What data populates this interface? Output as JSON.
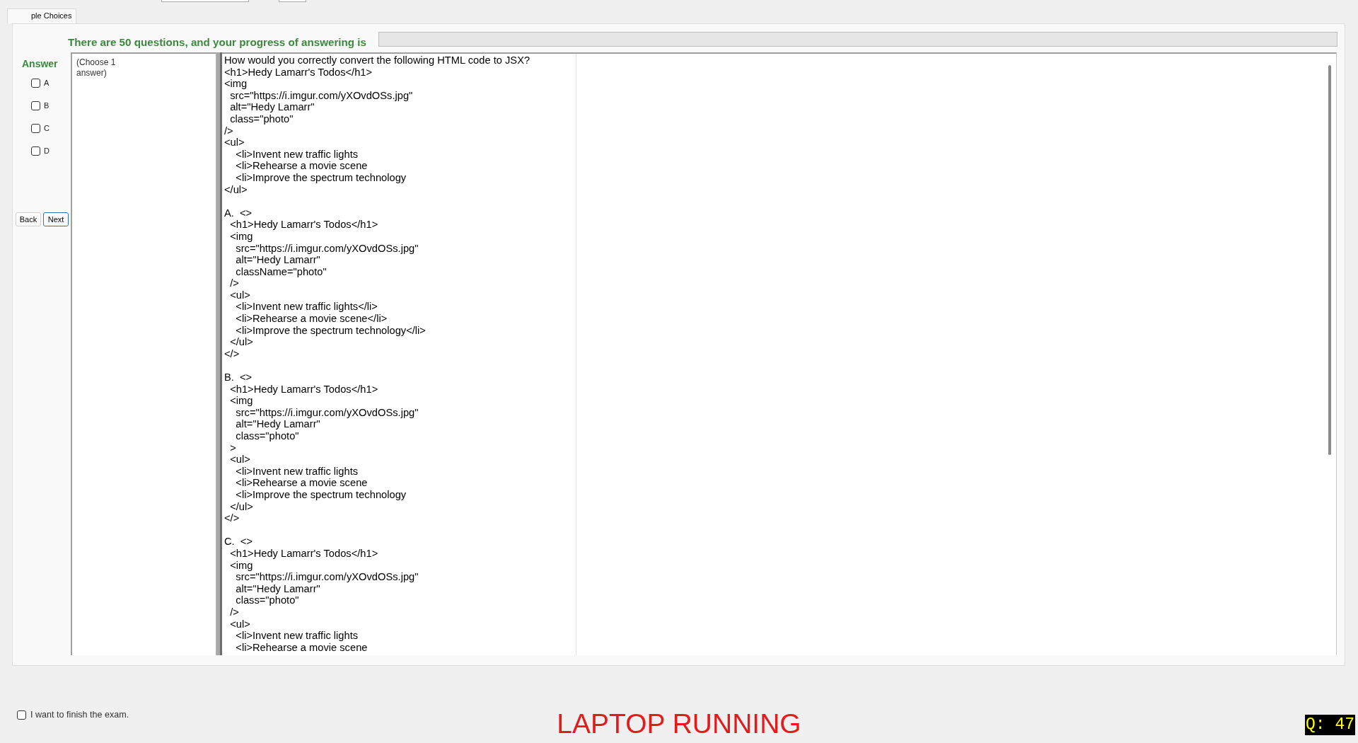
{
  "tab": {
    "label": "ple Choices",
    "selected": true
  },
  "progress": {
    "label": "There are 50 questions, and your progress of answering is"
  },
  "answer": {
    "title": "Answer",
    "options": [
      {
        "letter": "A",
        "checked": false
      },
      {
        "letter": "B",
        "checked": false
      },
      {
        "letter": "C",
        "checked": false
      },
      {
        "letter": "D",
        "checked": false
      }
    ],
    "buttons": [
      {
        "label": "Back",
        "focused": false
      },
      {
        "label": "Next",
        "focused": true
      }
    ]
  },
  "hint": "(Choose 1 answer)",
  "question": {
    "text": "How would you correctly convert the following HTML code to JSX?\n<h1>Hedy Lamarr's Todos</h1>\n<img\n  src=\"https://i.imgur.com/yXOvdOSs.jpg\"\n  alt=\"Hedy Lamarr\"\n  class=\"photo\"\n/>\n<ul>\n    <li>Invent new traffic lights\n    <li>Rehearse a movie scene\n    <li>Improve the spectrum technology\n</ul>\n\nA.  <>\n  <h1>Hedy Lamarr's Todos</h1>\n  <img\n    src=\"https://i.imgur.com/yXOvdOSs.jpg\"\n    alt=\"Hedy Lamarr\"\n    className=\"photo\"\n  />\n  <ul>\n    <li>Invent new traffic lights</li>\n    <li>Rehearse a movie scene</li>\n    <li>Improve the spectrum technology</li>\n  </ul>\n</>\n\nB.  <>\n  <h1>Hedy Lamarr's Todos</h1>\n  <img\n    src=\"https://i.imgur.com/yXOvdOSs.jpg\"\n    alt=\"Hedy Lamarr\"\n    class=\"photo\"\n  >\n  <ul>\n    <li>Invent new traffic lights\n    <li>Rehearse a movie scene\n    <li>Improve the spectrum technology\n  </ul>\n</>\n\nC.  <>\n  <h1>Hedy Lamarr's Todos</h1>\n  <img\n    src=\"https://i.imgur.com/yXOvdOSs.jpg\"\n    alt=\"Hedy Lamarr\"\n    class=\"photo\"\n  />\n  <ul>\n    <li>Invent new traffic lights\n    <li>Rehearse a movie scene"
  },
  "finish": {
    "label": "I want to finish the exam.",
    "checked": false
  },
  "status": "LAPTOP RUNNING",
  "question_counter": "Q: 47"
}
